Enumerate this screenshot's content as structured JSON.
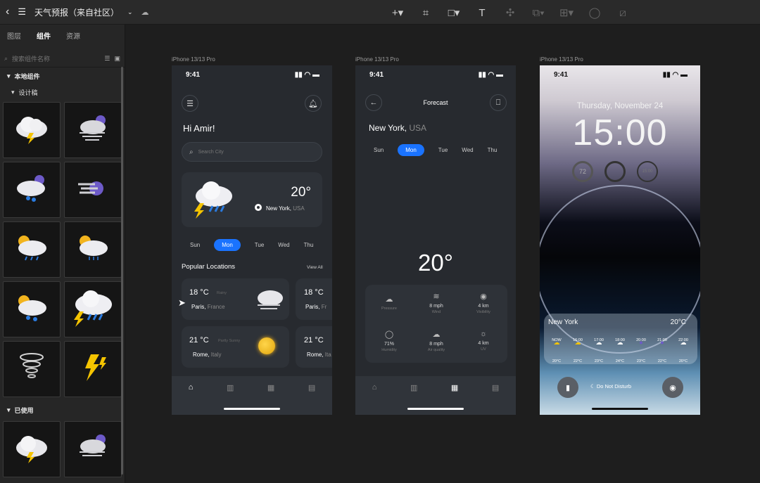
{
  "topbar": {
    "file_title": "天气预报（来自社区）",
    "icons": [
      "back-chevron-icon",
      "menu-icon",
      "dropdown-icon",
      "cloud-sync-icon"
    ],
    "tools": [
      "add-icon",
      "frame-icon",
      "rectangle-icon",
      "text-icon",
      "component-icon",
      "boolean-icon",
      "align-icon",
      "mask-icon",
      "crop-icon"
    ]
  },
  "sidebar": {
    "tabs": [
      {
        "label": "图层"
      },
      {
        "label": "组件"
      },
      {
        "label": "资源"
      }
    ],
    "active_tab": "组件",
    "search_placeholder": "搜索组件名称",
    "local_section": "本地组件",
    "design_subsection": "设计稿",
    "used_section": "已使用",
    "tiles": [
      "storm-cloud-icon",
      "night-wind-icon",
      "night-rain-icon",
      "moon-wind-icon",
      "sun-rain-icon",
      "sun-drizzle-icon",
      "sun-showers-icon",
      "heavy-storm-icon",
      "tornado-icon",
      "lightning-icon"
    ],
    "used_tiles": [
      "storm-cloud-icon",
      "night-wind-icon"
    ]
  },
  "frames": [
    {
      "label": "iPhone 13/13 Pro"
    },
    {
      "label": "iPhone 13/13 Pro"
    },
    {
      "label": "iPhone 13/13 Pro"
    }
  ],
  "phone1": {
    "time": "9:41",
    "greeting": "Hi Amir!",
    "search_placeholder": "Search City",
    "main_temp": "20°",
    "main_city": "New York,",
    "main_country": "USA",
    "days": [
      "Sun",
      "Mon",
      "Tue",
      "Wed",
      "Thu"
    ],
    "active_day": "Mon",
    "popular_title": "Popular Locations",
    "view_all": "View All",
    "locations": [
      {
        "temp": "18 °C",
        "desc": "Rainy",
        "city": "Paris,",
        "country": "France"
      },
      {
        "temp": "18 °C",
        "desc": "",
        "city": "Paris,",
        "country": "Fr"
      },
      {
        "temp": "21 °C",
        "desc": "Partly Sunny",
        "city": "Rome,",
        "country": "Italy"
      },
      {
        "temp": "21 °C",
        "desc": "",
        "city": "Rome,",
        "country": "Ita"
      }
    ]
  },
  "phone2": {
    "time": "9:41",
    "title": "Forecast",
    "city": "New York,",
    "country": "USA",
    "days": [
      "Sun",
      "Mon",
      "Tue",
      "Wed",
      "Thu"
    ],
    "active_day": "Mon",
    "temp": "20°",
    "stats": [
      {
        "value": "",
        "label": "Pressure",
        "icon": "pressure-icon"
      },
      {
        "value": "8 mph",
        "label": "Wind",
        "icon": "wind-icon"
      },
      {
        "value": "4 km",
        "label": "Visibility",
        "icon": "eye-icon"
      },
      {
        "value": "71%",
        "label": "Humidity",
        "icon": "drop-icon"
      },
      {
        "value": "8 mph",
        "label": "Air quality",
        "icon": "cloud-icon"
      },
      {
        "value": "4 km",
        "label": "UV",
        "icon": "sun-icon"
      }
    ]
  },
  "phone3": {
    "time": "9:41",
    "date": "Thursday, November 24",
    "clock": "15:00",
    "widgets": [
      "72",
      "",
      "15:00"
    ],
    "widget_city": "New York",
    "widget_temp": "20°C",
    "hours": [
      "NOW",
      "16:00",
      "17:00",
      "18:00",
      "20:00",
      "21:00",
      "22:00"
    ],
    "hour_temps": [
      "20°C",
      "22°C",
      "23°C",
      "24°C",
      "23°C",
      "22°C",
      "20°C"
    ],
    "dnd": "Do Not Disturb"
  }
}
